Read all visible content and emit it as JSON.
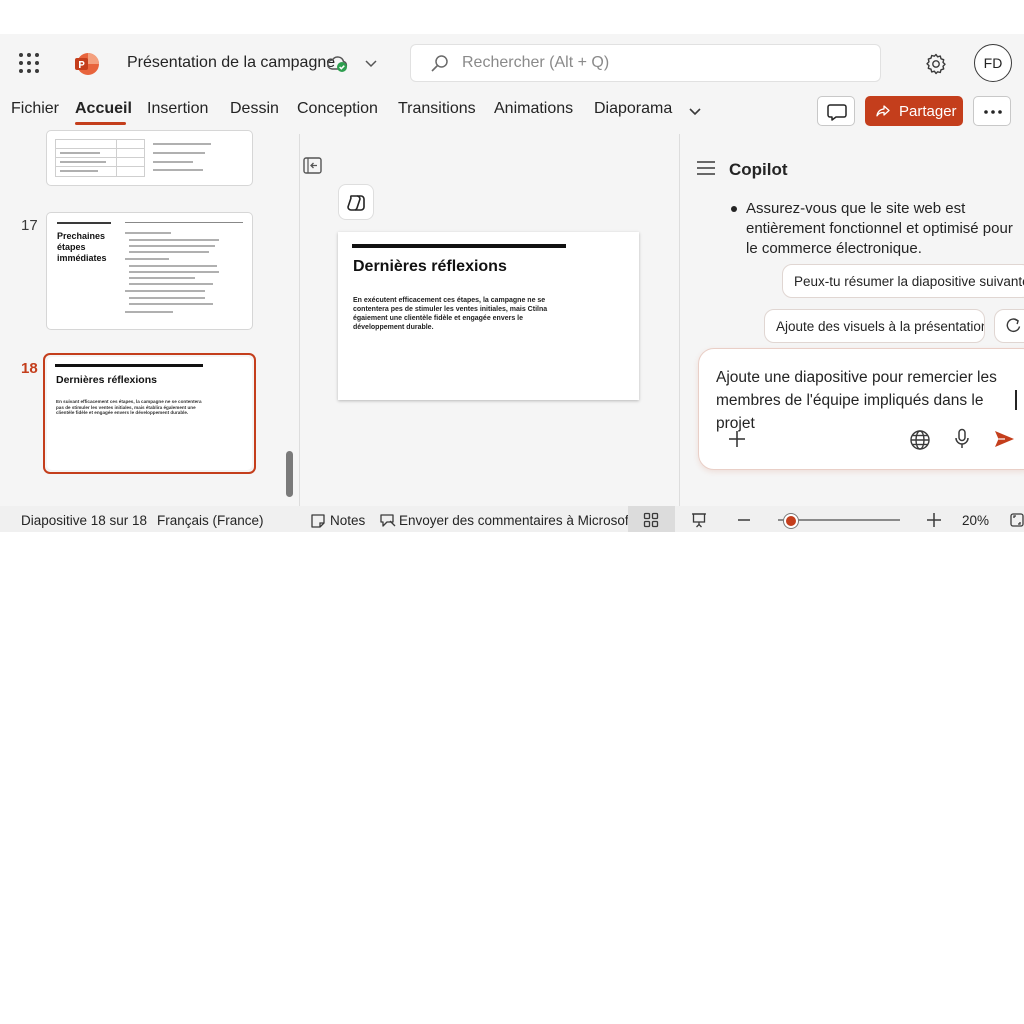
{
  "window": {
    "doc_title": "Présentation de la campagne",
    "search_placeholder": "Rechercher (Alt + Q)",
    "avatar_initials": "FD"
  },
  "ribbon": {
    "tabs": [
      {
        "label": "Fichier",
        "active": false
      },
      {
        "label": "Accueil",
        "active": true
      },
      {
        "label": "Insertion",
        "active": false
      },
      {
        "label": "Dessin",
        "active": false
      },
      {
        "label": "Conception",
        "active": false
      },
      {
        "label": "Transitions",
        "active": false
      },
      {
        "label": "Animations",
        "active": false
      },
      {
        "label": "Diaporama",
        "active": false
      }
    ],
    "share_label": "Partager"
  },
  "thumbnails": {
    "slide17": {
      "number": "17",
      "title": "Prechaines étapes immédiates"
    },
    "slide18": {
      "number": "18",
      "title": "Dernières réflexions",
      "body": "En suivant efficacement ces étapes, la campagne ne se contentera pas de stimuler les ventes initiales, mais établira également une clientèle fidèle et engagée envers le développement durable."
    }
  },
  "slide": {
    "title": "Dernières réflexions",
    "body": "En exécutent efficacement ces étapes, la campagne ne se contentera pes de stimuler les ventes initiales, mais Ctilna égaiement une clientèle fidèle et engagée envers le développement durable."
  },
  "copilot": {
    "title": "Copilot",
    "bullet": "Assurez-vous que le site web est entièrement fonctionnel et optimisé pour le commerce électronique.",
    "suggestions": [
      "Peux-tu résumer la diapositive suivante ?",
      "Ajoute des visuels à la présentation."
    ],
    "compose_text": "Ajoute une diapositive pour remercier les membres de l'équipe impliqués dans le projet"
  },
  "status": {
    "slide_counter": "Diapositive 18 sur 18",
    "language": "Français (France)",
    "notes_label": "Notes",
    "feedback_label": "Envoyer des commentaires à Microsoft",
    "zoom": "20%",
    "zoom_value_percent": 20
  },
  "colors": {
    "accent": "#c43e1c",
    "background": "#f5f5f5",
    "status_bar": "#f0f0f0"
  }
}
